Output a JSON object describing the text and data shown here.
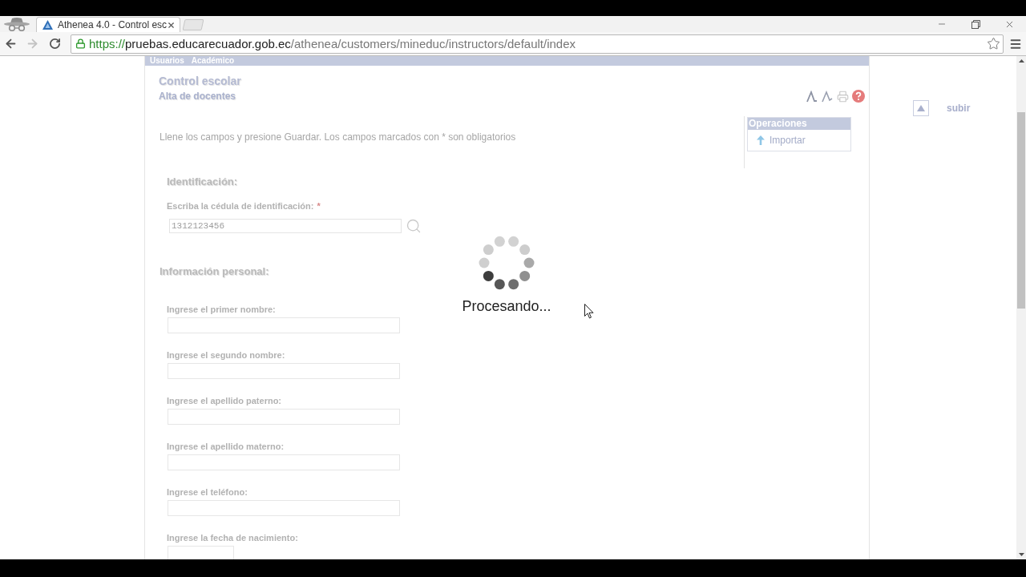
{
  "browser": {
    "tab": {
      "title": "Athenea 4.0 - Control esc"
    },
    "address": {
      "scheme": "https://",
      "host": "pruebas.educarecuador.gob.ec",
      "path": "/athenea/customers/mineduc/instructors/default/index"
    }
  },
  "top_menu": {
    "items": [
      "Usuarios",
      "Académico"
    ]
  },
  "header": {
    "title": "Control escolar",
    "subtitle": "Alta de docentes"
  },
  "instructions": "Llene los campos y presione Guardar. Los campos marcados con * son obligatorios",
  "operations": {
    "title": "Operaciones",
    "items": [
      {
        "label": "Importar"
      }
    ]
  },
  "sections": [
    {
      "title": "Identificación:",
      "fields": [
        {
          "kind": "search",
          "label": "Escriba la cédula de identificación:",
          "required_mark": "*",
          "value": "1312123456"
        }
      ]
    },
    {
      "title": "Información personal:",
      "fields": [
        {
          "kind": "text",
          "label": "Ingrese el primer nombre:"
        },
        {
          "kind": "text",
          "label": "Ingrese el segundo nombre:"
        },
        {
          "kind": "text",
          "label": "Ingrese el apellido paterno:"
        },
        {
          "kind": "text",
          "label": "Ingrese el apellido materno:"
        },
        {
          "kind": "text",
          "label": "Ingrese el teléfono:"
        },
        {
          "kind": "date",
          "label": "Ingrese la fecha de nacimiento:"
        }
      ]
    }
  ],
  "loading": {
    "message": "Procesando..."
  },
  "scroll_top": {
    "label": "subir"
  }
}
